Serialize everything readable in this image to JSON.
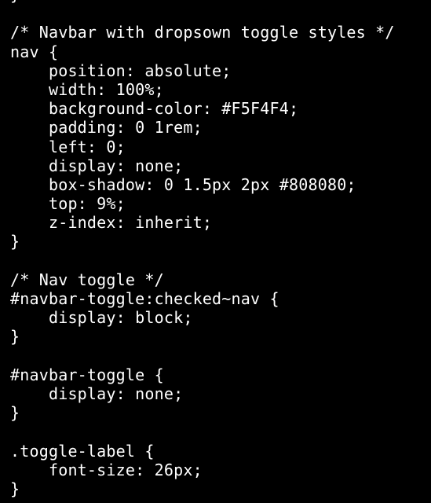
{
  "editor": {
    "text_color": "#FFFFFF",
    "background_color": "#000000",
    "lines": [
      "}",
      "",
      "/* Navbar with dropsown toggle styles */",
      "nav {",
      "    position: absolute;",
      "    width: 100%;",
      "    background-color: #F5F4F4;",
      "    padding: 0 1rem;",
      "    left: 0;",
      "    display: none;",
      "    box-shadow: 0 1.5px 2px #808080;",
      "    top: 9%;",
      "    z-index: inherit;",
      "}",
      "",
      "/* Nav toggle */",
      "#navbar-toggle:checked~nav {",
      "    display: block;",
      "}",
      "",
      "#navbar-toggle {",
      "    display: none;",
      "}",
      "",
      ".toggle-label {",
      "    font-size: 26px;",
      "}"
    ]
  }
}
